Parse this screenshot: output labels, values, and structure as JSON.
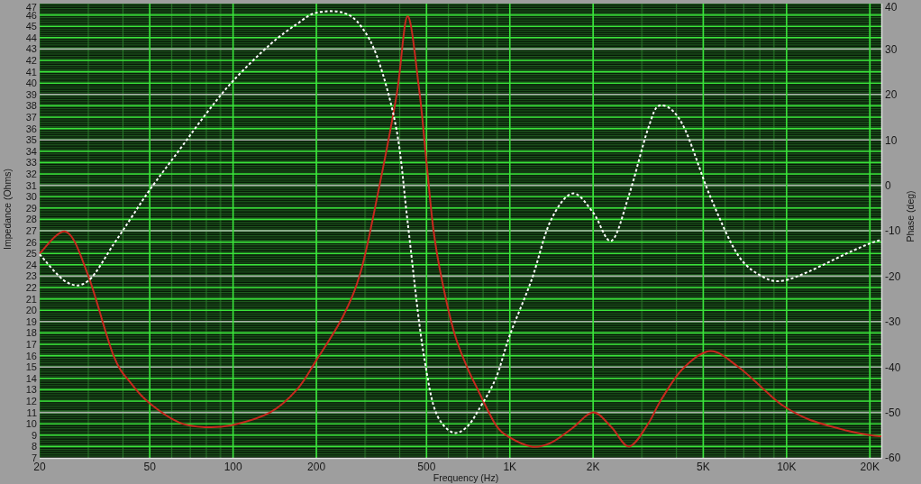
{
  "plot": {
    "chart_data": {
      "type": "line",
      "xlabel": "Frequency (Hz)",
      "ylabel": "Impedance (Ohms)",
      "y2label": "Phase (deg)",
      "log": "x",
      "grid": true,
      "x": [
        20,
        25,
        30,
        37,
        43,
        50,
        64,
        80,
        100,
        136,
        170,
        200,
        250,
        290,
        335,
        390,
        427,
        470,
        500,
        530,
        570,
        630,
        700,
        770,
        890,
        1000,
        1200,
        1400,
        1680,
        2000,
        2330,
        2700,
        3160,
        3500,
        4200,
        5300,
        6700,
        8300,
        9700,
        12000,
        16500,
        20000,
        22000
      ],
      "xlim": [
        20,
        22000
      ],
      "ylim": [
        7,
        47
      ],
      "y2lim": [
        -60,
        40
      ],
      "xticks": [
        20,
        50,
        100,
        200,
        500,
        {
          "value": 1000,
          "label": "1K"
        },
        {
          "value": 2000,
          "label": "2K"
        },
        {
          "value": 5000,
          "label": "5K"
        },
        {
          "value": 10000,
          "label": "10K"
        },
        {
          "value": 20000,
          "label": "20K"
        }
      ],
      "yticks": [
        7,
        8,
        9,
        10,
        11,
        12,
        13,
        14,
        15,
        16,
        17,
        18,
        19,
        20,
        21,
        22,
        23,
        24,
        25,
        26,
        27,
        28,
        29,
        30,
        31,
        32,
        33,
        34,
        35,
        36,
        37,
        38,
        39,
        40,
        41,
        42,
        43,
        44,
        45,
        46,
        47
      ],
      "y2ticks": [
        -60,
        -50,
        -40,
        -30,
        -20,
        -10,
        0,
        10,
        20,
        30,
        40
      ],
      "series": [
        {
          "color": "#c8281e",
          "line_style": "solid",
          "values": [
            25.0,
            26.9,
            23.0,
            16.0,
            13.5,
            11.8,
            10.1,
            9.7,
            9.9,
            11.0,
            13.0,
            15.6,
            19.5,
            23.5,
            30.5,
            39.0,
            45.9,
            39.5,
            33.0,
            27.0,
            22.5,
            18.0,
            15.0,
            12.9,
            9.9,
            8.8,
            8.0,
            8.3,
            9.6,
            11.0,
            9.7,
            8.0,
            10.0,
            12.0,
            14.8,
            16.4,
            15.0,
            13.0,
            11.6,
            10.4,
            9.4,
            9.0,
            8.9
          ]
        },
        {
          "color": "#ffffff",
          "line_style": "dashed",
          "axis": "y2",
          "values": [
            -15.2,
            -21.3,
            -21.0,
            -13.0,
            -7.0,
            -1.0,
            7.8,
            15.8,
            23.0,
            31.0,
            35.5,
            38.0,
            38.0,
            35.0,
            27.5,
            12.0,
            -8.0,
            -30.0,
            -41.0,
            -48.5,
            -52.5,
            -54.5,
            -53.2,
            -49.5,
            -42.5,
            -33.0,
            -20.7,
            -8.0,
            -1.8,
            -6.0,
            -12.2,
            -2.0,
            12.5,
            17.6,
            13.5,
            -2.5,
            -15.5,
            -20.3,
            -21.0,
            -19.0,
            -15.0,
            -12.8,
            -12.0
          ]
        }
      ]
    }
  }
}
